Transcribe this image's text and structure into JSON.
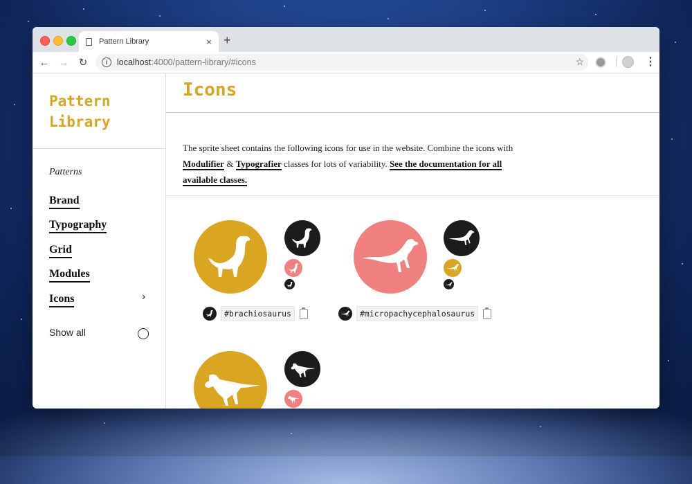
{
  "browser": {
    "tab_title": "Pattern Library",
    "tab_close": "×",
    "new_tab": "+",
    "url_host": "localhost",
    "url_path": ":4000/pattern-library/#icons",
    "back": "←",
    "forward": "→",
    "reload": "↻",
    "star": "☆",
    "menu": "⋮"
  },
  "sidebar": {
    "logo_line1": "Pattern",
    "logo_line2": "Library",
    "section_label": "Patterns",
    "items": [
      {
        "label": "Brand"
      },
      {
        "label": "Typography"
      },
      {
        "label": "Grid"
      },
      {
        "label": "Modules"
      },
      {
        "label": "Icons"
      }
    ],
    "chevron": "›",
    "show_all": "Show all"
  },
  "main": {
    "title": "Icons",
    "desc_1": "The sprite sheet contains the following icons for use in the website. Combine the icons with ",
    "link_modulifier": "Modulifier",
    "desc_amp": " & ",
    "link_typografier": "Typografier",
    "desc_2": " classes for lots of variability. ",
    "link_docs": "See the documentation for all available classes.",
    "icons": [
      {
        "name": "#brachiosaurus",
        "big_color": "#daa520",
        "mid_color": "#f08080"
      },
      {
        "name": "#micropachycephalosaurus",
        "big_color": "#f08080",
        "mid_color": "#daa520"
      },
      {
        "name": "",
        "big_color": "#daa520",
        "mid_color": "#f08080"
      }
    ]
  },
  "colors": {
    "gold": "#daa520",
    "pink": "#f08080",
    "black": "#1c1c1c"
  }
}
